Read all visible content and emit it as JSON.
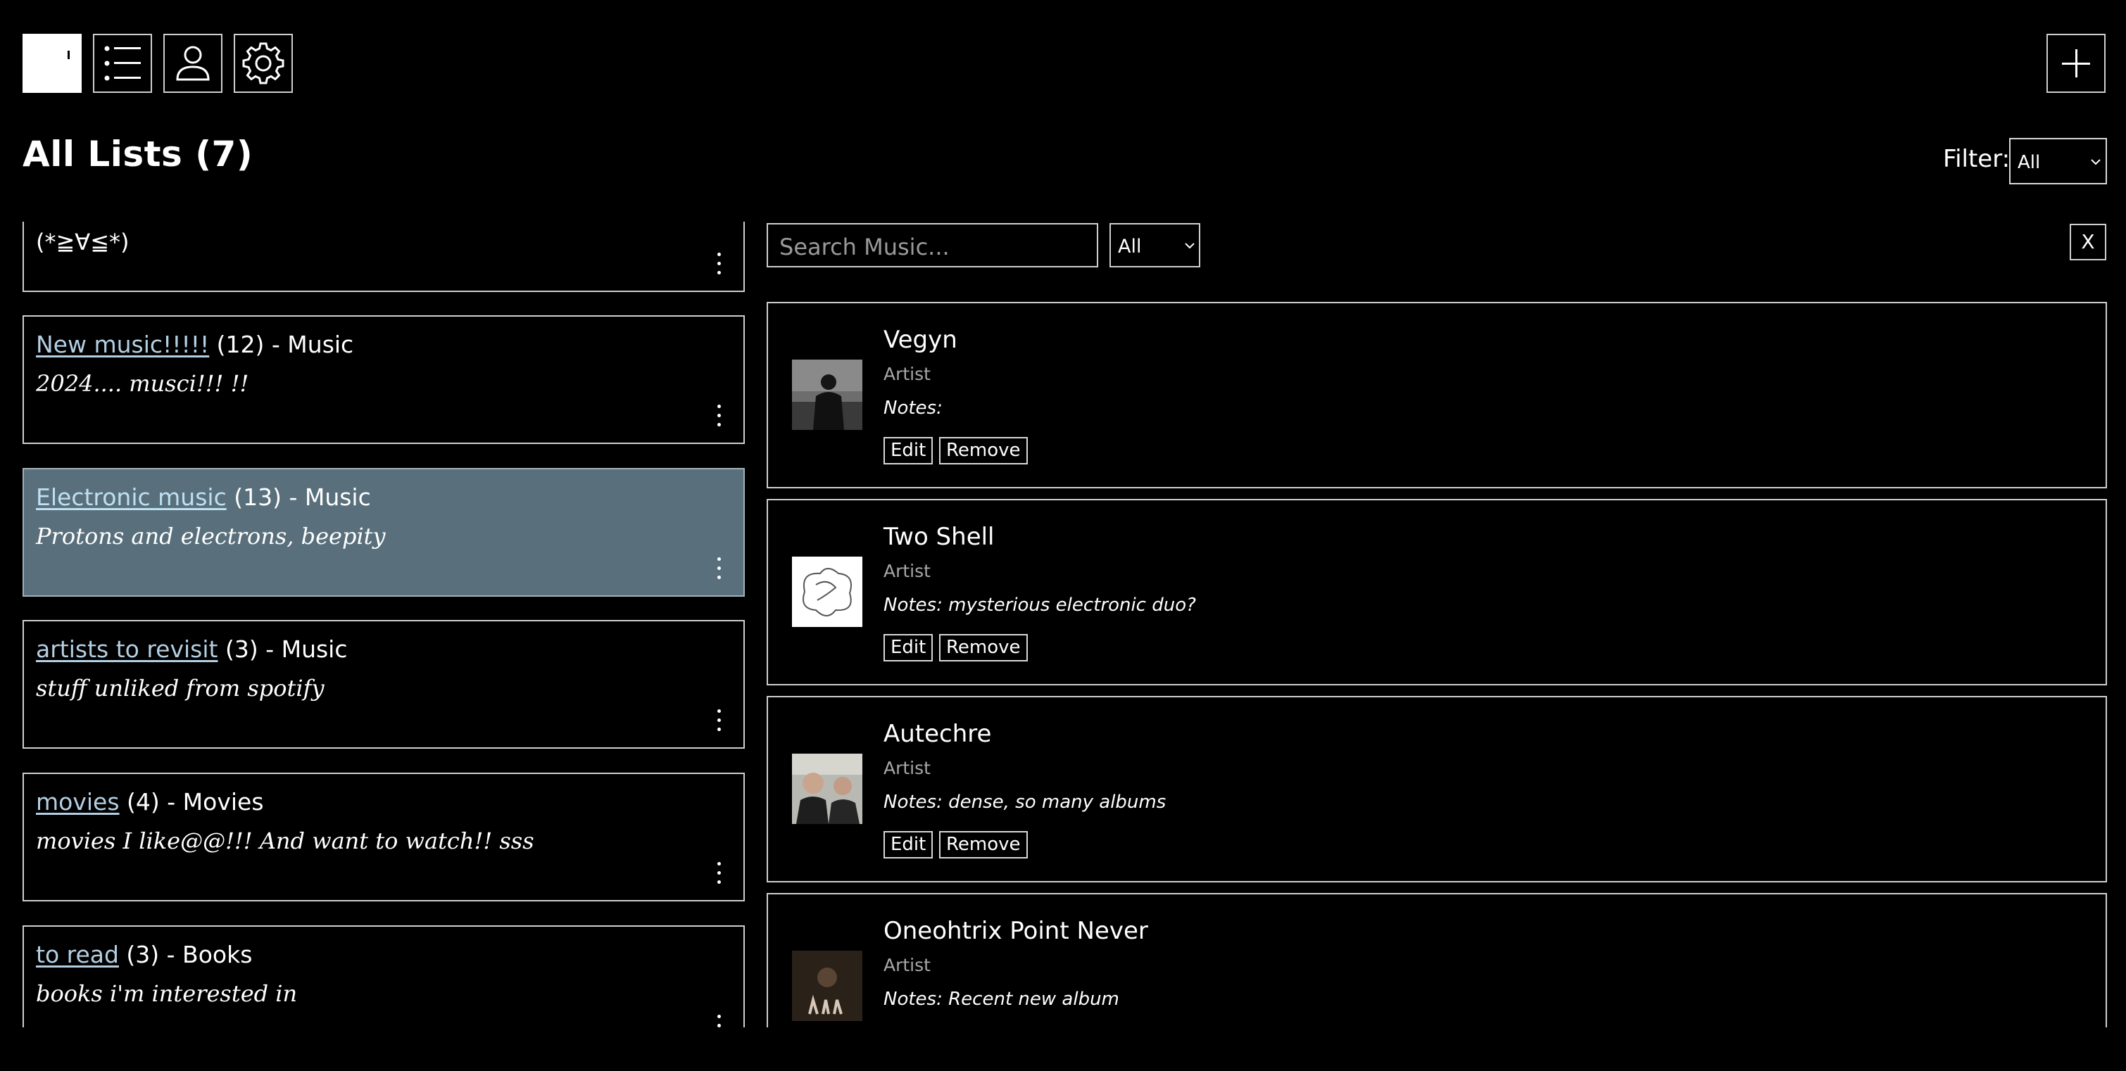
{
  "toolbar": {
    "icons": [
      "blank-icon",
      "list-icon",
      "user-icon",
      "gear-icon",
      "plus-icon"
    ]
  },
  "header": {
    "title": "All Lists (7)",
    "filter_label": "Filter:",
    "filter_value": "All"
  },
  "lists": [
    {
      "name": "",
      "meta": "",
      "desc": "(*≧∀≦*)"
    },
    {
      "name": "New music!!!!!",
      "meta": " (12) - Music",
      "desc": "2024.... musci!!! !!"
    },
    {
      "name": "Electronic music",
      "meta": " (13) - Music",
      "desc": "Protons and electrons, beepity",
      "selected": true
    },
    {
      "name": "artists to revisit",
      "meta": " (3) - Music",
      "desc": "stuff unliked from spotify"
    },
    {
      "name": "movies",
      "meta": " (4) - Movies",
      "desc": "movies I like@@!!! And want to watch!! sss"
    },
    {
      "name": "to read",
      "meta": " (3) - Books",
      "desc": "books i'm interested in"
    }
  ],
  "search": {
    "placeholder": "Search Music...",
    "type_value": "All",
    "close_label": "X"
  },
  "items": [
    {
      "name": "Vegyn",
      "type": "Artist",
      "notes": "Notes:"
    },
    {
      "name": "Two Shell",
      "type": "Artist",
      "notes": "Notes: mysterious electronic duo?"
    },
    {
      "name": "Autechre",
      "type": "Artist",
      "notes": "Notes: dense, so many albums"
    },
    {
      "name": "Oneohtrix Point Never",
      "type": "Artist",
      "notes": "Notes: Recent new album"
    }
  ],
  "buttons": {
    "edit": "Edit",
    "remove": "Remove"
  }
}
